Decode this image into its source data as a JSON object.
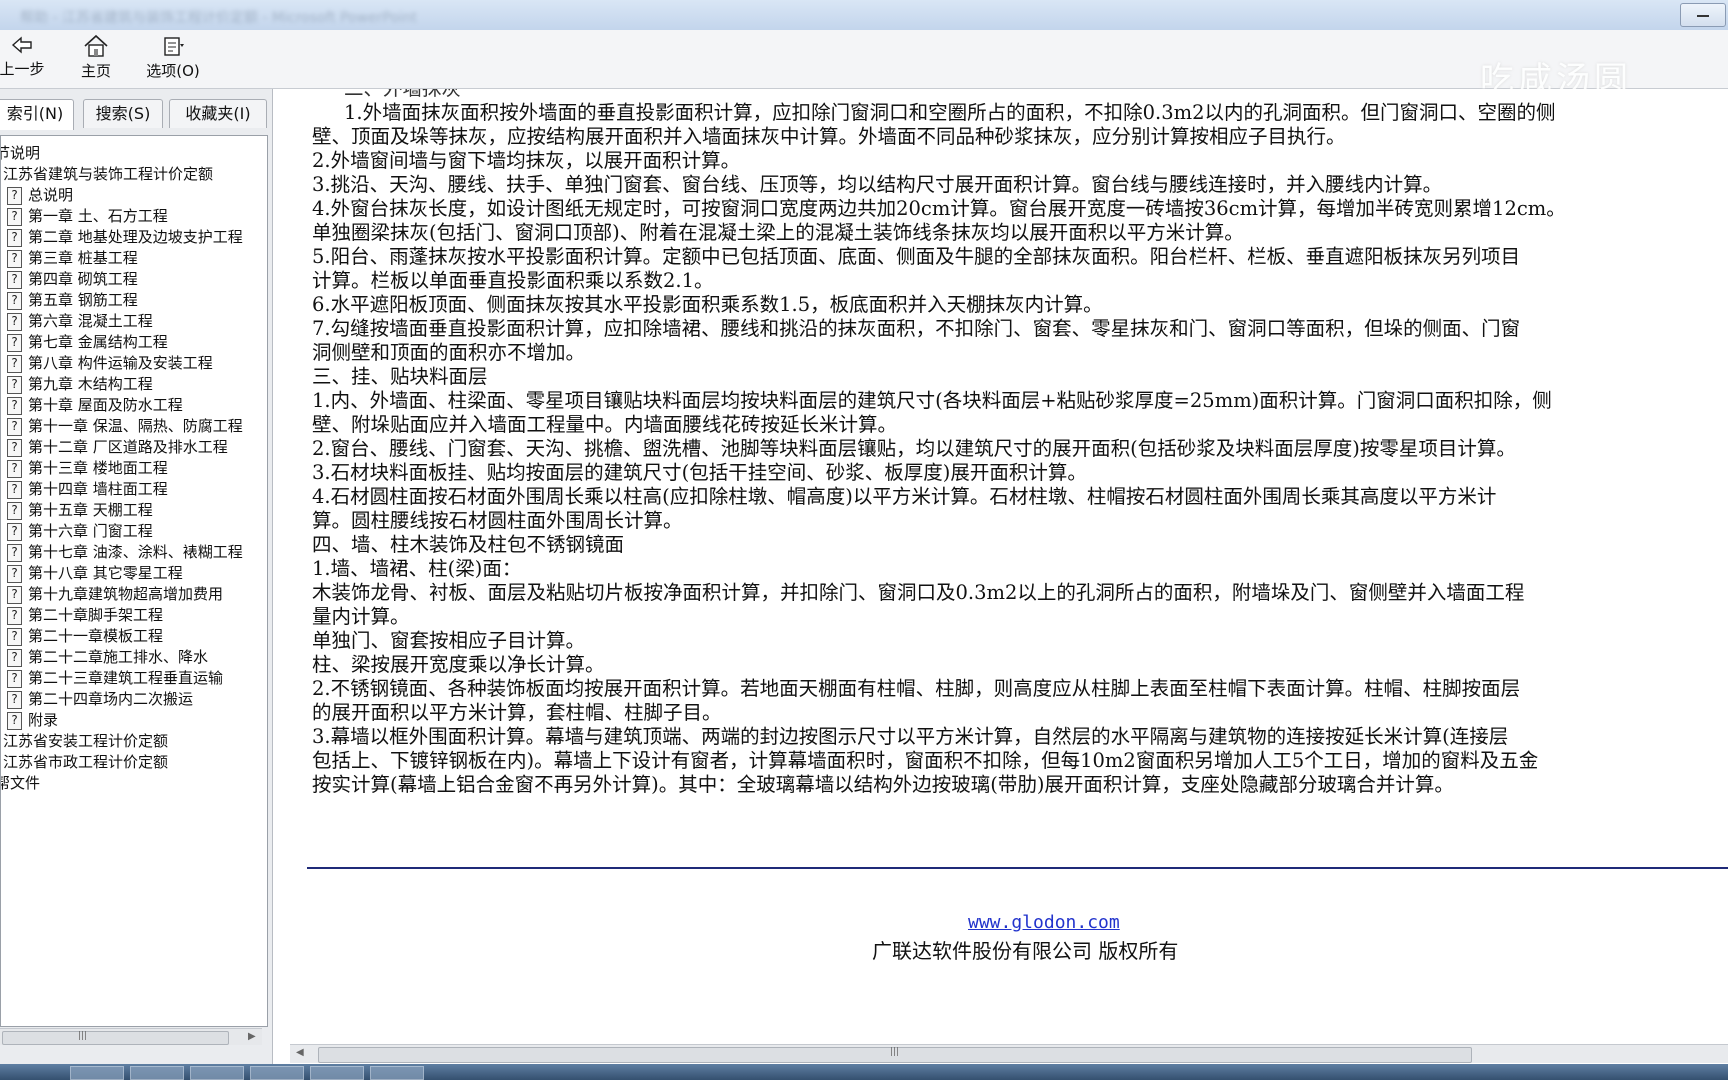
{
  "window": {
    "blurred_title": "帮助 - 江苏省建筑与装饰工程计价定额 - Microsoft PowerPoint"
  },
  "toolbar": {
    "back_label": "上一步",
    "home_label": "主页",
    "options_label": "选项(O)"
  },
  "watermark": "吃咸汤圆",
  "left_pane": {
    "tabs": [
      "索引(N)",
      "搜索(S)",
      "收藏夹(I)"
    ],
    "tree": [
      "节说明",
      "江苏省建筑与装饰工程计价定额",
      "总说明",
      "第一章 土、石方工程",
      "第二章 地基处理及边坡支护工程",
      "第三章 桩基工程",
      "第四章 砌筑工程",
      "第五章 钢筋工程",
      "第六章 混凝土工程",
      "第七章 金属结构工程",
      "第八章 构件运输及安装工程",
      "第九章 木结构工程",
      "第十章 屋面及防水工程",
      "第十一章 保温、隔热、防腐工程",
      "第十二章 厂区道路及排水工程",
      "第十三章 楼地面工程",
      "第十四章 墙柱面工程",
      "第十五章 天棚工程",
      "第十六章 门窗工程",
      "第十七章 油漆、涂料、裱糊工程",
      "第十八章 其它零星工程",
      "第十九章建筑物超高增加费用",
      "第二十章脚手架工程",
      "第二十一章模板工程",
      "第二十二章施工排水、降水",
      "第二十三章建筑工程垂直运输",
      "第二十四章场内二次搬运",
      "附录",
      "江苏省安装工程计价定额",
      "江苏省市政工程计价定额",
      "帮文件"
    ]
  },
  "content": {
    "lines": [
      "二、外墙抹灰",
      "1.外墙面抹灰面积按外墙面的垂直投影面积计算，应扣除门窗洞口和空圈所占的面积，不扣除0.3m2以内的孔洞面积。但门窗洞口、空圈的侧",
      "壁、顶面及垛等抹灰，应按结构展开面积并入墙面抹灰中计算。外墙面不同品种砂浆抹灰，应分别计算按相应子目执行。",
      "2.外墙窗间墙与窗下墙均抹灰，以展开面积计算。",
      "3.挑沿、天沟、腰线、扶手、单独门窗套、窗台线、压顶等，均以结构尺寸展开面积计算。窗台线与腰线连接时，并入腰线内计算。",
      "4.外窗台抹灰长度，如设计图纸无规定时，可按窗洞口宽度两边共加20cm计算。窗台展开宽度一砖墙按36cm计算，每增加半砖宽则累增12cm。",
      "单独圈梁抹灰(包括门、窗洞口顶部)、附着在混凝土梁上的混凝土装饰线条抹灰均以展开面积以平方米计算。",
      "5.阳台、雨蓬抹灰按水平投影面积计算。定额中已包括顶面、底面、侧面及牛腿的全部抹灰面积。阳台栏杆、栏板、垂直遮阳板抹灰另列项目",
      "计算。栏板以单面垂直投影面积乘以系数2.1。",
      "6.水平遮阳板顶面、侧面抹灰按其水平投影面积乘系数1.5，板底面积并入天棚抹灰内计算。",
      "7.勾缝按墙面垂直投影面积计算，应扣除墙裙、腰线和挑沿的抹灰面积，不扣除门、窗套、零星抹灰和门、窗洞口等面积，但垛的侧面、门窗",
      "洞侧壁和顶面的面积亦不增加。",
      "三、挂、贴块料面层",
      "1.内、外墙面、柱梁面、零星项目镶贴块料面层均按块料面层的建筑尺寸(各块料面层+粘贴砂浆厚度=25mm)面积计算。门窗洞口面积扣除，侧",
      "壁、附垛贴面应并入墙面工程量中。内墙面腰线花砖按延长米计算。",
      "2.窗台、腰线、门窗套、天沟、挑檐、盥洗槽、池脚等块料面层镶贴，均以建筑尺寸的展开面积(包括砂浆及块料面层厚度)按零星项目计算。",
      "3.石材块料面板挂、贴均按面层的建筑尺寸(包括干挂空间、砂浆、板厚度)展开面积计算。",
      "4.石材圆柱面按石材面外围周长乘以柱高(应扣除柱墩、帽高度)以平方米计算。石材柱墩、柱帽按石材圆柱面外围周长乘其高度以平方米计",
      "算。圆柱腰线按石材圆柱面外围周长计算。",
      "四、墙、柱木装饰及柱包不锈钢镜面",
      "1.墙、墙裙、柱(梁)面：",
      "木装饰龙骨、衬板、面层及粘贴切片板按净面积计算，并扣除门、窗洞口及0.3m2以上的孔洞所占的面积，附墙垛及门、窗侧壁并入墙面工程",
      "量内计算。",
      "单独门、窗套按相应子目计算。",
      "柱、梁按展开宽度乘以净长计算。",
      "2.不锈钢镜面、各种装饰板面均按展开面积计算。若地面天棚面有柱帽、柱脚，则高度应从柱脚上表面至柱帽下表面计算。柱帽、柱脚按面层",
      "的展开面积以平方米计算，套柱帽、柱脚子目。",
      "3.幕墙以框外围面积计算。幕墙与建筑顶端、两端的封边按图示尺寸以平方米计算，自然层的水平隔离与建筑物的连接按延长米计算(连接层",
      "包括上、下镀锌钢板在内)。幕墙上下设计有窗者，计算幕墙面积时，窗面积不扣除，但每10m2窗面积另增加人工5个工日，增加的窗料及五金",
      "按实计算(幕墙上铝合金窗不再另外计算)。其中：全玻璃幕墙以结构外边按玻璃(带肋)展开面积计算，支座处隐藏部分玻璃合并计算。"
    ],
    "footer_url": "www.glodon.com",
    "footer_copyright": "广联达软件股份有限公司 版权所有"
  },
  "icons": [
    "back-arrow-icon",
    "home-icon",
    "options-icon",
    "help-page-icon",
    "minimize-icon",
    "scroll-grip-icon"
  ],
  "colors": {
    "accent_rule": "#1f2a78",
    "link": "#2233cc"
  }
}
